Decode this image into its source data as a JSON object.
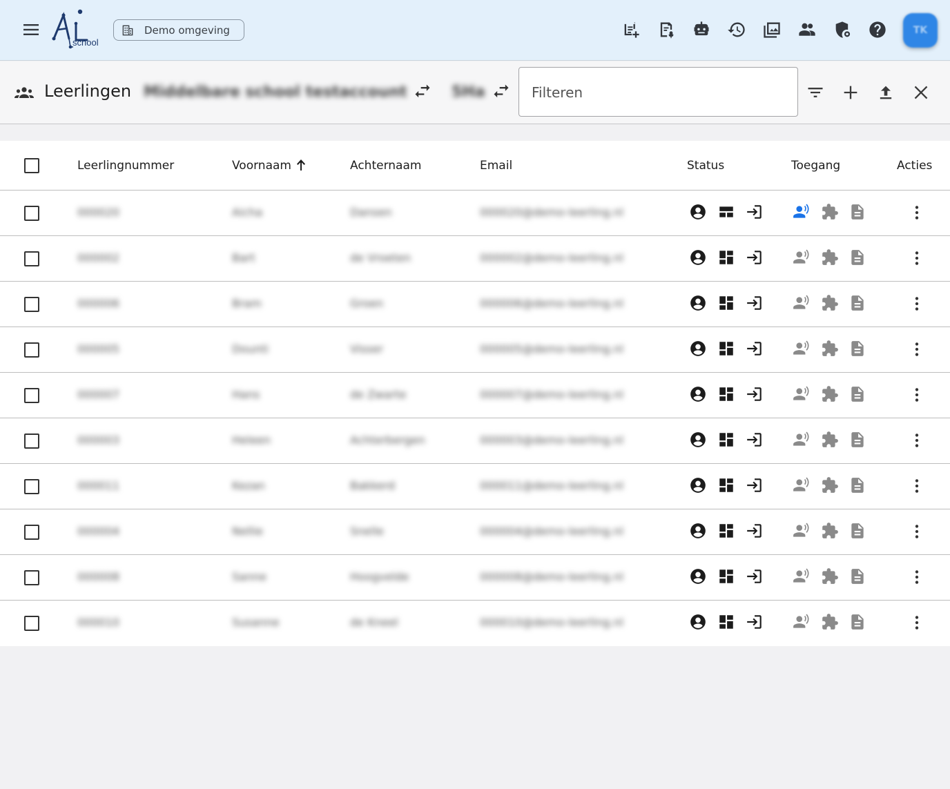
{
  "header": {
    "logo_text": "Ai",
    "logo_subtext": "school",
    "environment_label": "Demo omgeving",
    "avatar_initials": "TK",
    "icons": [
      "post-add-icon",
      "assignment-voice-icon",
      "robot-icon",
      "history-icon",
      "photo-library-icon",
      "people-icon",
      "shield-settings-icon",
      "help-icon"
    ]
  },
  "toolbar": {
    "title": "Leerlingen",
    "school_name": "Middelbare school testaccount",
    "class_name": "5Ha",
    "filter_placeholder": "Filteren"
  },
  "table": {
    "columns": {
      "number": "Leerlingnummer",
      "first_name": "Voornaam",
      "last_name": "Achternaam",
      "email": "Email",
      "status": "Status",
      "access": "Toegang",
      "actions": "Acties"
    },
    "sort": {
      "column": "first_name",
      "direction": "ascending"
    },
    "rows": [
      {
        "number": "000020",
        "first_name": "Aicha",
        "last_name": "Dansen",
        "email": "000020@demo-leerling.nl",
        "voice_access_active": true
      },
      {
        "number": "000002",
        "first_name": "Bart",
        "last_name": "de Vroeten",
        "email": "000002@demo-leerling.nl",
        "voice_access_active": false
      },
      {
        "number": "000006",
        "first_name": "Bram",
        "last_name": "Groen",
        "email": "000006@demo-leerling.nl",
        "voice_access_active": false
      },
      {
        "number": "000005",
        "first_name": "Dounti",
        "last_name": "Visser",
        "email": "000005@demo-leerling.nl",
        "voice_access_active": false
      },
      {
        "number": "000007",
        "first_name": "Hans",
        "last_name": "de Zwarte",
        "email": "000007@demo-leerling.nl",
        "voice_access_active": false
      },
      {
        "number": "000003",
        "first_name": "Heleen",
        "last_name": "Achterbergen",
        "email": "000003@demo-leerling.nl",
        "voice_access_active": false
      },
      {
        "number": "000011",
        "first_name": "Kezan",
        "last_name": "Bakkerd",
        "email": "000011@demo-leerling.nl",
        "voice_access_active": false
      },
      {
        "number": "000004",
        "first_name": "Nellie",
        "last_name": "Snelle",
        "email": "000004@demo-leerling.nl",
        "voice_access_active": false
      },
      {
        "number": "000008",
        "first_name": "Sanne",
        "last_name": "Hoogvelde",
        "email": "000008@demo-leerling.nl",
        "voice_access_active": false
      },
      {
        "number": "000010",
        "first_name": "Susanne",
        "last_name": "de Kneel",
        "email": "000010@demo-leerling.nl",
        "voice_access_active": false
      }
    ]
  },
  "colors": {
    "appbar_bg": "#e3f0fb",
    "accent_blue": "#1a73e8",
    "avatar_bg": "#2f86e6"
  }
}
